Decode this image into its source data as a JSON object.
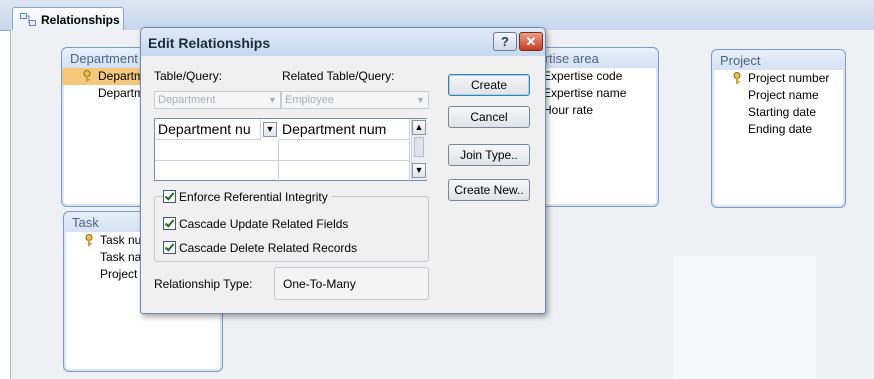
{
  "tab": {
    "label": "Relationships",
    "icon": "relationships-icon"
  },
  "tables": {
    "department": {
      "title": "Department",
      "fields": [
        "Department number",
        "Department name"
      ]
    },
    "task": {
      "title": "Task",
      "fields": [
        "Task number",
        "Task name",
        "Project number"
      ]
    },
    "expertise": {
      "title": "Expertise area",
      "fields": [
        "Expertise code",
        "Expertise name",
        "Hour rate"
      ]
    },
    "project": {
      "title": "Project",
      "fields": [
        "Project number",
        "Project name",
        "Starting date",
        "Ending date"
      ]
    }
  },
  "dialog": {
    "title": "Edit Relationships",
    "help_label": "?",
    "close_label": "✕",
    "table_query_label": "Table/Query:",
    "related_table_label": "Related Table/Query:",
    "table_value": "Department",
    "related_value": "Employee",
    "grid_left_value": "Department nu",
    "grid_right_value": "Department num",
    "buttons": {
      "create": "Create",
      "cancel": "Cancel",
      "join_type": "Join Type..",
      "create_new": "Create New.."
    },
    "checkboxes": {
      "enforce": "Enforce Referential Integrity",
      "cascade_update": "Cascade Update Related Fields",
      "cascade_delete": "Cascade Delete Related Records"
    },
    "relationship_type_label": "Relationship Type:",
    "relationship_type_value": "One-To-Many"
  }
}
